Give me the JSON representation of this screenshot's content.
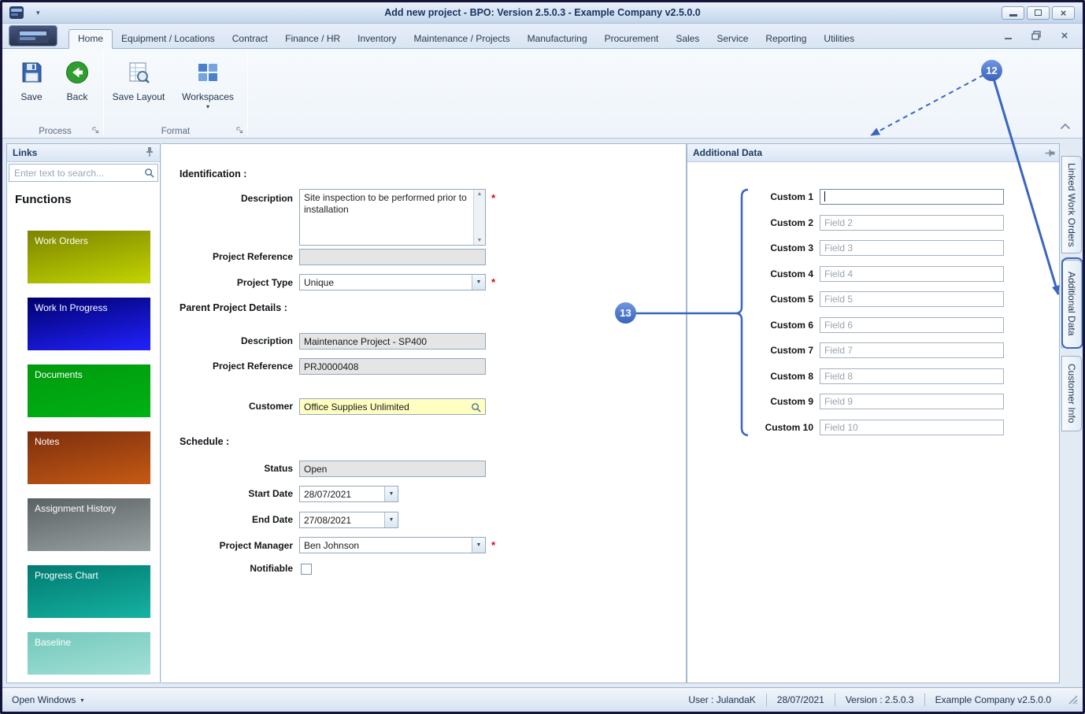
{
  "colors": {
    "annotation_blue": "#3a65c0",
    "required_red": "#e00018",
    "customer_field_yellow": "#ffffc2",
    "readonly_gray": "#e5e5e5"
  },
  "window": {
    "title": "Add new project - BPO: Version 2.5.0.3 - Example Company v2.5.0.0"
  },
  "ribbon": {
    "tabs": [
      "Home",
      "Equipment / Locations",
      "Contract",
      "Finance / HR",
      "Inventory",
      "Maintenance / Projects",
      "Manufacturing",
      "Procurement",
      "Sales",
      "Service",
      "Reporting",
      "Utilities"
    ],
    "active_tab": "Home",
    "buttons": {
      "save": "Save",
      "back": "Back",
      "save_layout": "Save Layout",
      "workspaces": "Workspaces"
    },
    "groups": {
      "process": "Process",
      "format": "Format"
    }
  },
  "links_panel": {
    "title": "Links",
    "search_placeholder": "Enter text to search...",
    "functions_header": "Functions",
    "tiles": [
      {
        "label": "Work Orders",
        "c1": "#7c8400",
        "c2": "#c2d500"
      },
      {
        "label": "Work In Progress",
        "c1": "#00006e",
        "c2": "#2222ff"
      },
      {
        "label": "Documents",
        "c1": "#009a0e",
        "c2": "#00b214"
      },
      {
        "label": "Notes",
        "c1": "#7c2e0e",
        "c2": "#c65a14"
      },
      {
        "label": "Assignment History",
        "c1": "#5a6163",
        "c2": "#9aa2a4"
      },
      {
        "label": "Progress Chart",
        "c1": "#007a70",
        "c2": "#16b2a2"
      },
      {
        "label": "Baseline",
        "c1": "#74c8bc",
        "c2": "#a2e0d6"
      }
    ]
  },
  "form": {
    "identification_header": "Identification :",
    "description": {
      "label": "Description",
      "value": "Site inspection to be performed prior to installation"
    },
    "project_reference": {
      "label": "Project Reference",
      "value": ""
    },
    "project_type": {
      "label": "Project Type",
      "value": "Unique"
    },
    "parent_header": "Parent Project Details :",
    "parent_description": {
      "label": "Description",
      "value": "Maintenance Project - SP400"
    },
    "parent_reference": {
      "label": "Project Reference",
      "value": "PRJ0000408"
    },
    "customer": {
      "label": "Customer",
      "value": "Office Supplies Unlimited"
    },
    "schedule_header": "Schedule :",
    "status": {
      "label": "Status",
      "value": "Open"
    },
    "start_date": {
      "label": "Start Date",
      "value": "28/07/2021"
    },
    "end_date": {
      "label": "End Date",
      "value": "27/08/2021"
    },
    "project_manager": {
      "label": "Project Manager",
      "value": "Ben Johnson"
    },
    "notifiable": {
      "label": "Notifiable",
      "checked": false
    }
  },
  "additional_data": {
    "title": "Additional Data",
    "fields": [
      {
        "label": "Custom 1",
        "value": "",
        "placeholder": ""
      },
      {
        "label": "Custom 2",
        "value": "",
        "placeholder": "Field 2"
      },
      {
        "label": "Custom 3",
        "value": "",
        "placeholder": "Field 3"
      },
      {
        "label": "Custom 4",
        "value": "",
        "placeholder": "Field 4"
      },
      {
        "label": "Custom 5",
        "value": "",
        "placeholder": "Field 5"
      },
      {
        "label": "Custom 6",
        "value": "",
        "placeholder": "Field 6"
      },
      {
        "label": "Custom 7",
        "value": "",
        "placeholder": "Field 7"
      },
      {
        "label": "Custom 8",
        "value": "",
        "placeholder": "Field 8"
      },
      {
        "label": "Custom 9",
        "value": "",
        "placeholder": "Field 9"
      },
      {
        "label": "Custom 10",
        "value": "",
        "placeholder": "Field 10"
      }
    ]
  },
  "side_tabs": [
    "Linked Work Orders",
    "Additional Data",
    "Customer Info"
  ],
  "status_bar": {
    "open_windows": "Open Windows",
    "user": "User : JulandaK",
    "date": "28/07/2021",
    "version": "Version : 2.5.0.3",
    "company": "Example Company v2.5.0.0"
  },
  "annotations": {
    "callout_12": "12",
    "callout_13": "13"
  }
}
